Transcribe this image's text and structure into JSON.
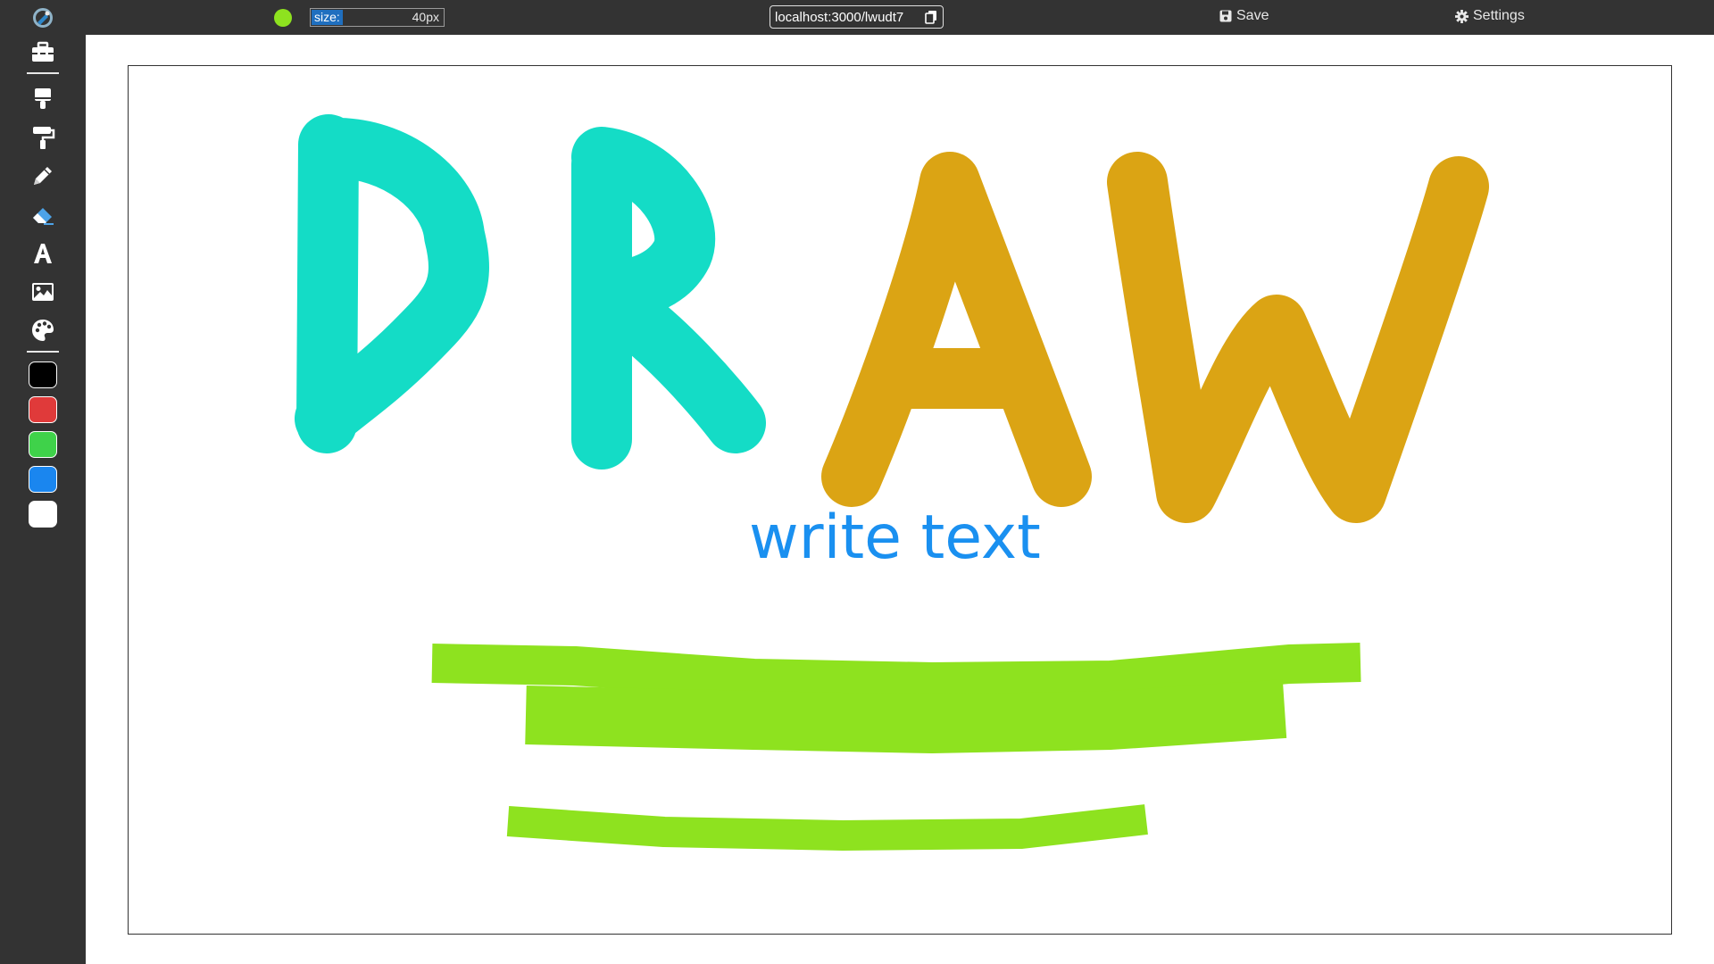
{
  "toolbar": {
    "current_color": "#8ee21f",
    "size_label": "size:",
    "size_value": "40px",
    "url": "localhost:3000/lwudt7",
    "save_label": "Save",
    "settings_label": "Settings"
  },
  "sidebar": {
    "tools": [
      {
        "name": "toolbox-icon",
        "active": false
      },
      {
        "name": "brush-icon",
        "active": false
      },
      {
        "name": "paint-roller-icon",
        "active": false
      },
      {
        "name": "pencil-icon",
        "active": false
      },
      {
        "name": "eraser-icon",
        "active": true
      },
      {
        "name": "text-icon",
        "active": false
      },
      {
        "name": "image-icon",
        "active": false
      },
      {
        "name": "palette-icon",
        "active": false
      }
    ],
    "swatches": [
      "#000000",
      "#e03a3a",
      "#3fd24a",
      "#1a86ef",
      "#ffffff"
    ]
  },
  "canvas": {
    "text": "write text",
    "text_color": "#1a90f0",
    "stroke_colors": {
      "teal": "#14dcc6",
      "gold": "#dba414",
      "lime": "#8ee21f"
    }
  }
}
